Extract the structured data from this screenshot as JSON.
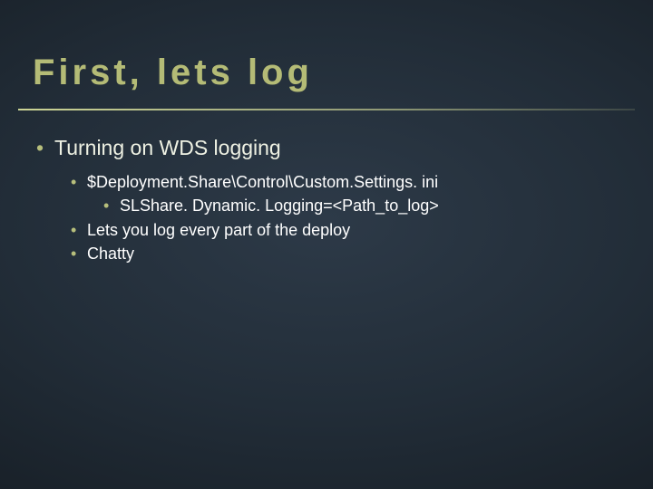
{
  "slide": {
    "title": "First, lets log",
    "bullets": {
      "b1": "Turning on WDS logging",
      "b1_1": "$Deployment.Share\\Control\\Custom.Settings. ini",
      "b1_1_1": "SLShare. Dynamic. Logging=<Path_to_log>",
      "b1_2": "Lets you log every part of the deploy",
      "b1_3": "Chatty"
    },
    "colors": {
      "title": "#b4bb76",
      "bullet": "#b7bf7c",
      "body": "#ffffff"
    }
  }
}
